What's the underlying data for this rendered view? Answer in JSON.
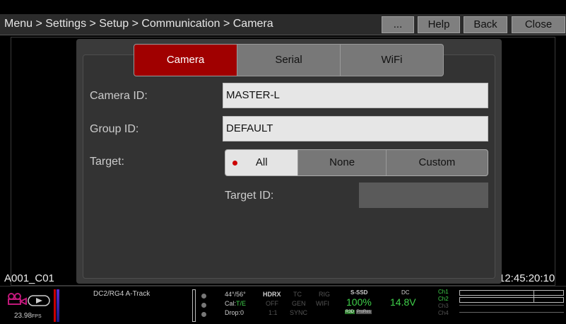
{
  "titlebar": {
    "breadcrumb": "Menu > Settings > Setup > Communication > Camera",
    "buttons": {
      "more": "...",
      "help": "Help",
      "back": "Back",
      "close": "Close"
    }
  },
  "tabs": {
    "camera": "Camera",
    "serial": "Serial",
    "wifi": "WiFi",
    "active": "Camera"
  },
  "form": {
    "camera_id_label": "Camera ID:",
    "camera_id_value": "MASTER-L",
    "group_id_label": "Group ID:",
    "group_id_value": "DEFAULT",
    "target_label": "Target:",
    "target_options": [
      "All",
      "None",
      "Custom"
    ],
    "target_selected": "All",
    "target_id_label": "Target ID:",
    "target_id_value": ""
  },
  "viewport": {
    "clip_name": "A001_C01",
    "timecode": "12:45:20:10"
  },
  "status": {
    "fps": "23.98",
    "fps_unit": "FPS",
    "sync_info": "DC2/RG4 A-Track",
    "shutter": "44°/56°",
    "cal_label": "Cal:",
    "cal_value": "T/E",
    "drop": "Drop:0",
    "hdrx": "HDRX",
    "hdrx_value": "OFF",
    "hdrx_ratio": "1:1",
    "tc": "TC",
    "gen": "GEN",
    "sync": "SYNC",
    "rig": "RIG",
    "wifi": "WIFI",
    "media_label": "S-SSD",
    "media_value": "100%",
    "media_tags": [
      "R3D",
      "ProRes"
    ],
    "power_label": "DC",
    "power_value": "14.8V",
    "channels": [
      "Ch1",
      "Ch2",
      "Ch3",
      "Ch4"
    ]
  },
  "icons": {
    "camera": "camera-record-icon",
    "playback": "playback-icon"
  },
  "colors": {
    "accent_red": "#a00000",
    "status_green": "#3fd04a"
  }
}
